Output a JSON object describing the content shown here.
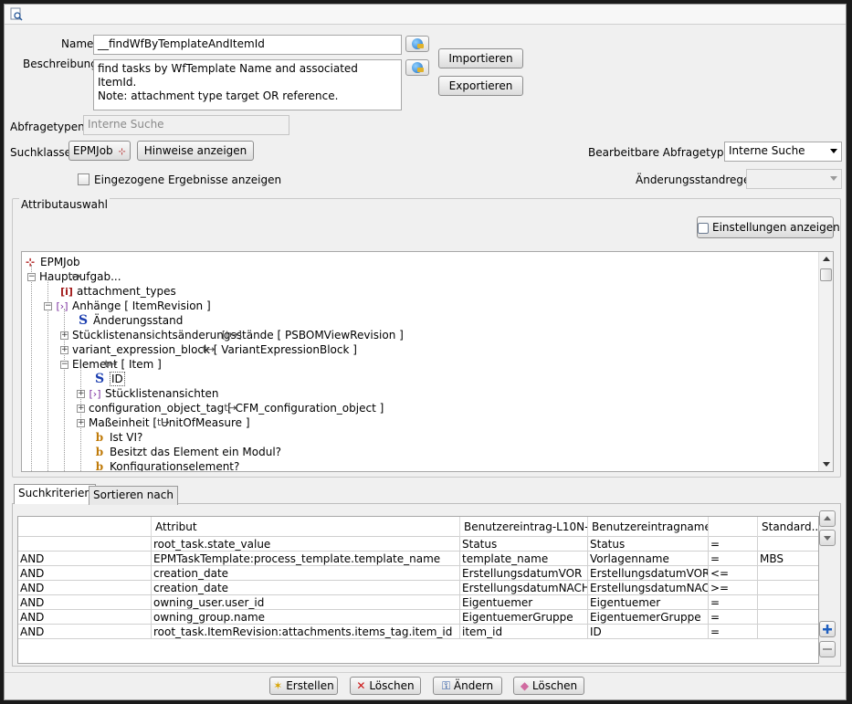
{
  "toolbar": {
    "icon": "search-document-icon"
  },
  "form": {
    "name_label": "Name:",
    "name_value": "__findWfByTemplateAndItemId",
    "desc_label": "Beschreibung:",
    "desc_line1": "find tasks by WfTemplate Name and associated ItemId.",
    "desc_line2": "Note: attachment type target OR reference.",
    "import_label": "Importieren",
    "export_label": "Exportieren",
    "querytype_label": "Abfragetypen:",
    "querytype_value": "Interne Suche",
    "searchclass_label": "Suchklasse:",
    "searchclass_value": "EPMJob",
    "hints_label": "Hinweise anzeigen",
    "editable_label": "Bearbeitbare Abfragetypen:",
    "editable_value": "Interne Suche",
    "retracted_label": "Eingezogene Ergebnisse anzeigen",
    "revrule_label": "Änderungsstandregel:"
  },
  "attr": {
    "group_label": "Attributauswahl",
    "settings_label": "Einstellungen anzeigen",
    "tree": [
      {
        "icon": "epmjob",
        "label": "EPMJob"
      },
      {
        "icon": "tr",
        "label": "Hauptaufgab..."
      },
      {
        "icon": "i",
        "label": "attachment_types"
      },
      {
        "icon": "ref",
        "label": "Anhänge [ ItemRevision ]"
      },
      {
        "icon": "S",
        "label": "Änderungsstand"
      },
      {
        "icon": "tr",
        "label": "Stücklistenansichtsänderungsstände [ PSBOMViewRevision ]"
      },
      {
        "icon": "tr",
        "label": "variant_expression_block [ VariantExpressionBlock ]"
      },
      {
        "icon": "tr",
        "label": "Element [ Item ]"
      },
      {
        "icon": "S",
        "label": "ID"
      },
      {
        "icon": "ref",
        "label": "Stücklistenansichten"
      },
      {
        "icon": "tr",
        "label": "configuration_object_tag [ CFM_configuration_object ]"
      },
      {
        "icon": "tr",
        "label": "Maßeinheit [ UnitOfMeasure ]"
      },
      {
        "icon": "b",
        "label": "Ist VI?"
      },
      {
        "icon": "b",
        "label": "Besitzt das Element ein Modul?"
      },
      {
        "icon": "b",
        "label": "Konfigurationselement?"
      }
    ]
  },
  "tabs": {
    "criteria": "Suchkriterien",
    "sort": "Sortieren nach"
  },
  "table": {
    "headers": [
      "",
      "Attribut",
      "Benutzereintrag-L10N-...",
      "Benutzereintragname",
      "",
      "Standard..."
    ],
    "rows": [
      [
        "",
        "root_task.state_value",
        "Status",
        "Status",
        "=",
        ""
      ],
      [
        "AND",
        "EPMTaskTemplate:process_template.template_name",
        "template_name",
        "Vorlagenname",
        "=",
        "MBS"
      ],
      [
        "AND",
        "creation_date",
        "ErstellungsdatumVOR",
        "ErstellungsdatumVOR",
        "<=",
        ""
      ],
      [
        "AND",
        "creation_date",
        "ErstellungsdatumNACH",
        "ErstellungsdatumNACH",
        ">=",
        ""
      ],
      [
        "AND",
        "owning_user.user_id",
        "Eigentuemer",
        "Eigentuemer",
        "=",
        ""
      ],
      [
        "AND",
        "owning_group.name",
        "EigentuemerGruppe",
        "EigentuemerGruppe",
        "=",
        ""
      ],
      [
        "AND",
        "root_task.ItemRevision:attachments.items_tag.item_id",
        "item_id",
        "ID",
        "=",
        ""
      ]
    ]
  },
  "bottom": {
    "create_label": "Erstellen",
    "delete1_label": "Löschen",
    "change_label": "Ändern",
    "delete2_label": "Löschen"
  }
}
